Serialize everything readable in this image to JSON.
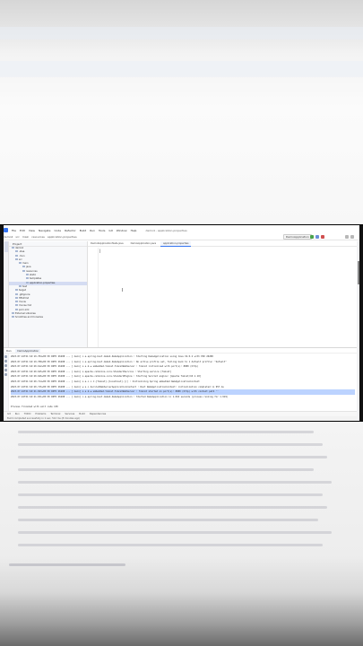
{
  "menu": {
    "project_name": "demo4",
    "items": [
      "File",
      "Edit",
      "View",
      "Navigate",
      "Code",
      "Refactor",
      "Build",
      "Run",
      "Tools",
      "Git",
      "Window",
      "Help"
    ],
    "window_title": "demo4 - application.properties"
  },
  "toolbar": {
    "breadcrumb": [
      "demo4",
      "src",
      "main",
      "resources",
      "application.properties"
    ],
    "run_config": "DemoApplication"
  },
  "project_panel": {
    "title": "Project",
    "tree": [
      {
        "label": "demo4",
        "sel": false,
        "indent": 0
      },
      {
        "label": ".idea",
        "sel": false,
        "indent": 1
      },
      {
        "label": ".mvn",
        "sel": false,
        "indent": 1
      },
      {
        "label": "src",
        "sel": false,
        "indent": 1
      },
      {
        "label": "main",
        "sel": false,
        "indent": 2
      },
      {
        "label": "java",
        "sel": false,
        "indent": 3
      },
      {
        "label": "resources",
        "sel": false,
        "indent": 3
      },
      {
        "label": "static",
        "sel": false,
        "indent": 4
      },
      {
        "label": "templates",
        "sel": false,
        "indent": 4
      },
      {
        "label": "application.properties",
        "sel": true,
        "indent": 4
      },
      {
        "label": "test",
        "sel": false,
        "indent": 2
      },
      {
        "label": "target",
        "sel": false,
        "indent": 1
      },
      {
        "label": ".gitignore",
        "sel": false,
        "indent": 1
      },
      {
        "label": "HELP.md",
        "sel": false,
        "indent": 1
      },
      {
        "label": "mvnw",
        "sel": false,
        "indent": 1
      },
      {
        "label": "mvnw.cmd",
        "sel": false,
        "indent": 1
      },
      {
        "label": "pom.xml",
        "sel": false,
        "indent": 1
      },
      {
        "label": "External Libraries",
        "sel": false,
        "indent": 0
      },
      {
        "label": "Scratches and Consoles",
        "sel": false,
        "indent": 0
      }
    ]
  },
  "editor": {
    "tabs": [
      {
        "label": "Demo4ApplicationTests.java",
        "active": false
      },
      {
        "label": "DemoApplication.java",
        "active": false
      },
      {
        "label": "application.properties",
        "active": true
      }
    ],
    "caret_text": "|"
  },
  "run": {
    "label": "Run:",
    "tab": "DemoApplication",
    "lines": [
      {
        "text": "2023-07-16T21:16:19.704+05:30  INFO 26208 --- [           main] c.e.spring.boot.demo4.DemoApplication  : Starting DemoApplication using Java 19.0.2 with PID 26208",
        "hl": false
      },
      {
        "text": "2023-07-16T21:16:19.708+05:30  INFO 26208 --- [           main] c.e.spring.boot.demo4.DemoApplication  : No active profile set, falling back to 1 default profile: \"default\"",
        "hl": false
      },
      {
        "text": "2023-07-16T21:16:20.612+05:30  INFO 26208 --- [           main] o.s.b.w.embedded.tomcat.TomcatWebServer : Tomcat initialized with port(s): 8080 (http)",
        "hl": false
      },
      {
        "text": "2023-07-16T21:16:20.625+05:30  INFO 26208 --- [           main] o.apache.catalina.core.StandardService  : Starting service [Tomcat]",
        "hl": false
      },
      {
        "text": "2023-07-16T21:16:20.626+05:30  INFO 26208 --- [           main] o.apache.catalina.core.StandardEngine   : Starting Servlet engine: [Apache Tomcat/10.1.10]",
        "hl": false
      },
      {
        "text": "2023-07-16T21:16:20.714+05:30  INFO 26208 --- [           main] o.a.c.c.C.[Tomcat].[localhost].[/]      : Initializing Spring embedded WebApplicationContext",
        "hl": false
      },
      {
        "text": "2023-07-16T21:16:20.715+05:30  INFO 26208 --- [           main] w.s.c.ServletWebServerApplicationContext : Root WebApplicationContext: initialization completed in 957 ms",
        "hl": false
      },
      {
        "text": "2023-07-16T21:16:21.023+05:30  INFO 26208 --- [           main] o.s.b.w.embedded.tomcat.TomcatWebServer : Tomcat started on port(s): 8080 (http) with context path ''",
        "hl": true
      },
      {
        "text": "2023-07-16T21:16:21.031+05:30  INFO 26208 --- [           main] c.e.spring.boot.demo4.DemoApplication  : Started DemoApplication in 1.616 seconds (process running for 1.919)",
        "hl": false
      },
      {
        "text": "",
        "hl": false
      },
      {
        "text": "Process finished with exit code 130",
        "hl": false
      }
    ]
  },
  "bottom_tools": [
    "Git",
    "Run",
    "TODO",
    "Problems",
    "Terminal",
    "Services",
    "Build",
    "Dependencies"
  ],
  "status": {
    "text": "Build completed successfully in 1 sec, 512 ms (8 minutes ago)"
  }
}
